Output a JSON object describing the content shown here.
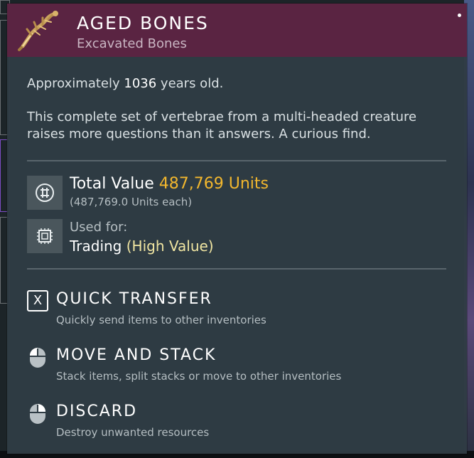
{
  "item": {
    "title": "AGED BONES",
    "subtitle": "Excavated Bones",
    "age_prefix": "Approximately",
    "age_value": "1036",
    "age_suffix": "years old.",
    "description": "This complete set of vertebrae from a multi-headed creature raises more questions than it answers. A curious find."
  },
  "value": {
    "label": "Total Value",
    "amount": "487,769 Units",
    "each": "(487,769.0 Units each)",
    "icon": "units-icon"
  },
  "usage": {
    "label": "Used for:",
    "value": "Trading",
    "qualifier": "(High Value)",
    "icon": "chip-icon"
  },
  "actions": [
    {
      "key": "X",
      "title": "QUICK TRANSFER",
      "desc": "Quickly send items to other inventories",
      "icon": "x-key-icon"
    },
    {
      "title": "MOVE AND STACK",
      "desc": "Stack items, split stacks or move to other inventories",
      "icon": "mouse-left-icon"
    },
    {
      "title": "DISCARD",
      "desc": "Destroy unwanted resources",
      "icon": "mouse-right-icon"
    }
  ],
  "colors": {
    "header": "#5a2442",
    "panel": "#2f3c44",
    "accent_value": "#f2b72e",
    "accent_high": "#f1e6a2"
  }
}
